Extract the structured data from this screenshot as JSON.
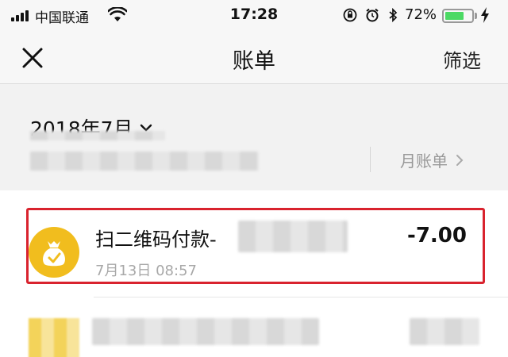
{
  "status_bar": {
    "carrier": "中国联通",
    "time": "17:28",
    "battery_percent": "72%",
    "battery_level": 0.72,
    "icons": [
      "signal-icon",
      "wifi-icon",
      "orientation-lock-icon",
      "alarm-icon",
      "bluetooth-icon",
      "battery-icon",
      "charging-icon"
    ]
  },
  "nav": {
    "title": "账单",
    "filter_label": "筛选",
    "close_icon": "close-icon"
  },
  "month_header": {
    "month": "2018年7月",
    "month_bill_label": "月账单"
  },
  "transactions": [
    {
      "title": "扫二维码付款-",
      "time": "7月13日 08:57",
      "amount": "-7.00",
      "icon": "money-bag-icon",
      "icon_color": "#f1bd1e"
    }
  ],
  "colors": {
    "highlight": "#d9232e",
    "battery": "#4cd964",
    "muted_text": "#a8a8a8"
  }
}
